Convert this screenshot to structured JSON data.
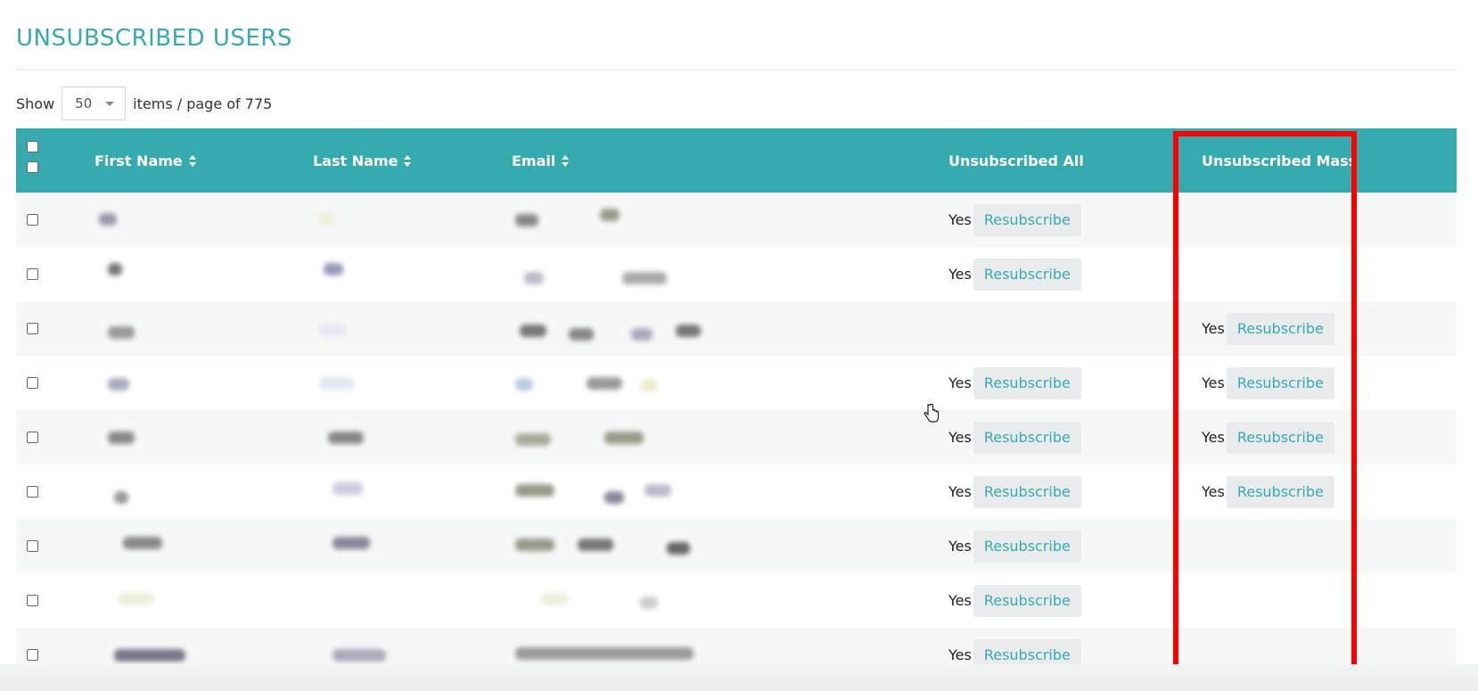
{
  "page": {
    "title": "UNSUBSCRIBED USERS"
  },
  "pagination": {
    "show_label": "Show",
    "page_size": "50",
    "suffix": "items / page of 775"
  },
  "table": {
    "columns": {
      "first_name": "First Name",
      "last_name": "Last Name",
      "email": "Email",
      "unsub_all": "Unsubscribed All",
      "unsub_mass": "Unsubscribed Mass"
    },
    "rows": [
      {
        "unsub_all": "Yes",
        "unsub_all_btn": "Resubscribe",
        "unsub_mass": "",
        "unsub_mass_btn": ""
      },
      {
        "unsub_all": "Yes",
        "unsub_all_btn": "Resubscribe",
        "unsub_mass": "",
        "unsub_mass_btn": ""
      },
      {
        "unsub_all": "",
        "unsub_all_btn": "",
        "unsub_mass": "Yes",
        "unsub_mass_btn": "Resubscribe"
      },
      {
        "unsub_all": "Yes",
        "unsub_all_btn": "Resubscribe",
        "unsub_mass": "Yes",
        "unsub_mass_btn": "Resubscribe"
      },
      {
        "unsub_all": "Yes",
        "unsub_all_btn": "Resubscribe",
        "unsub_mass": "Yes",
        "unsub_mass_btn": "Resubscribe"
      },
      {
        "unsub_all": "Yes",
        "unsub_all_btn": "Resubscribe",
        "unsub_mass": "Yes",
        "unsub_mass_btn": "Resubscribe"
      },
      {
        "unsub_all": "Yes",
        "unsub_all_btn": "Resubscribe",
        "unsub_mass": "",
        "unsub_mass_btn": ""
      },
      {
        "unsub_all": "Yes",
        "unsub_all_btn": "Resubscribe",
        "unsub_mass": "",
        "unsub_mass_btn": ""
      },
      {
        "unsub_all": "Yes",
        "unsub_all_btn": "Resubscribe",
        "unsub_mass": "",
        "unsub_mass_btn": ""
      }
    ]
  },
  "colors": {
    "accent": "#35abb0",
    "highlight": "#ff0000"
  },
  "icons": {
    "sort": "sort-arrows-icon",
    "caret": "chevron-down-icon",
    "cursor": "hand-pointer-icon"
  }
}
